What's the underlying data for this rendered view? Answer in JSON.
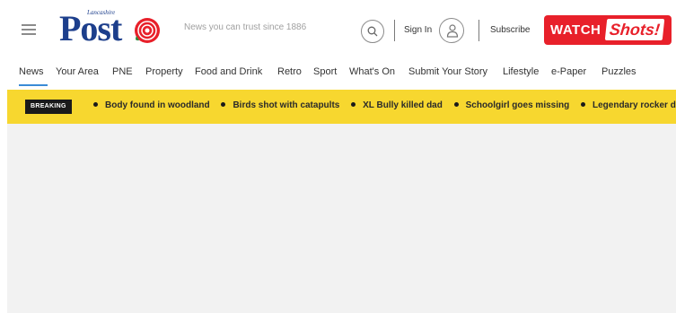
{
  "header": {
    "logo": {
      "small_text": "Lancashire",
      "main_text": "Post"
    },
    "tagline": "News you can trust since 1886",
    "sign_in_label": "Sign In",
    "subscribe_label": "Subscribe",
    "watch_button": {
      "watch_text": "WATCH",
      "shots_text": "Shots!"
    },
    "colors": {
      "brand_blue": "#1d3f8c",
      "watch_red": "#e8202a"
    }
  },
  "nav": {
    "items": [
      "News",
      "Your Area",
      "PNE",
      "Property",
      "Food and Drink",
      "Retro",
      "Sport",
      "What's On",
      "Submit Your Story",
      "Lifestyle",
      "e-Paper",
      "Puzzles"
    ],
    "active": "News",
    "active_color": "#3a8bd6"
  },
  "breaking": {
    "badge": "BREAKING",
    "headlines": [
      "Body found in woodland",
      "Birds shot with catapults",
      "XL Bully killed dad",
      "Schoolgirl goes missing",
      "Legendary rocker d"
    ],
    "bar_color": "#f7d72f"
  }
}
